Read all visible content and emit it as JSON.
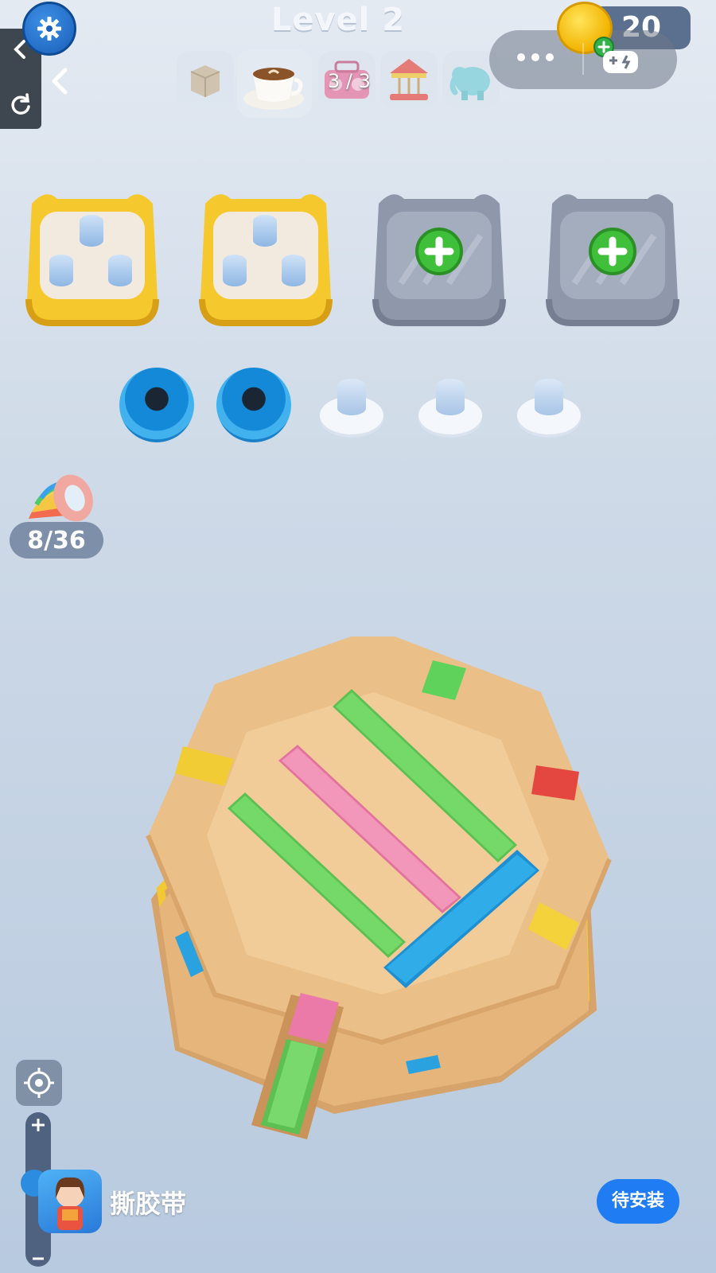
{
  "header": {
    "level_title": "Level 2",
    "coins": "20",
    "category_progress": "3 / 3",
    "categories": [
      {
        "icon": "cardboard-box-icon",
        "active": false
      },
      {
        "icon": "coffee-cup-icon",
        "active": true
      },
      {
        "icon": "radio-icon",
        "active": false
      },
      {
        "icon": "carousel-icon",
        "active": false
      },
      {
        "icon": "elephant-icon",
        "active": false
      }
    ]
  },
  "toolboxes": [
    {
      "state": "filled",
      "pegs": 3
    },
    {
      "state": "filled",
      "pegs": 3
    },
    {
      "state": "locked",
      "action": "add"
    },
    {
      "state": "locked",
      "action": "add"
    }
  ],
  "ring_slots": [
    {
      "state": "blue-ring"
    },
    {
      "state": "blue-ring"
    },
    {
      "state": "empty"
    },
    {
      "state": "empty"
    },
    {
      "state": "empty"
    }
  ],
  "tape_counter": "8/36",
  "tapes_on_board": [
    "green",
    "pink",
    "green",
    "blue",
    "yellow",
    "red",
    "yellow",
    "pink",
    "green",
    "blue",
    "blue"
  ],
  "colors": {
    "green": "#6fd35f",
    "pink": "#ef8fb4",
    "blue": "#2aa9e6",
    "yellow": "#f4d23c",
    "red": "#e4473f",
    "board": "#f0c48e",
    "accent": "#1f7cf2"
  },
  "ad": {
    "app_name": "撕胶带",
    "install_label": "待安装"
  }
}
